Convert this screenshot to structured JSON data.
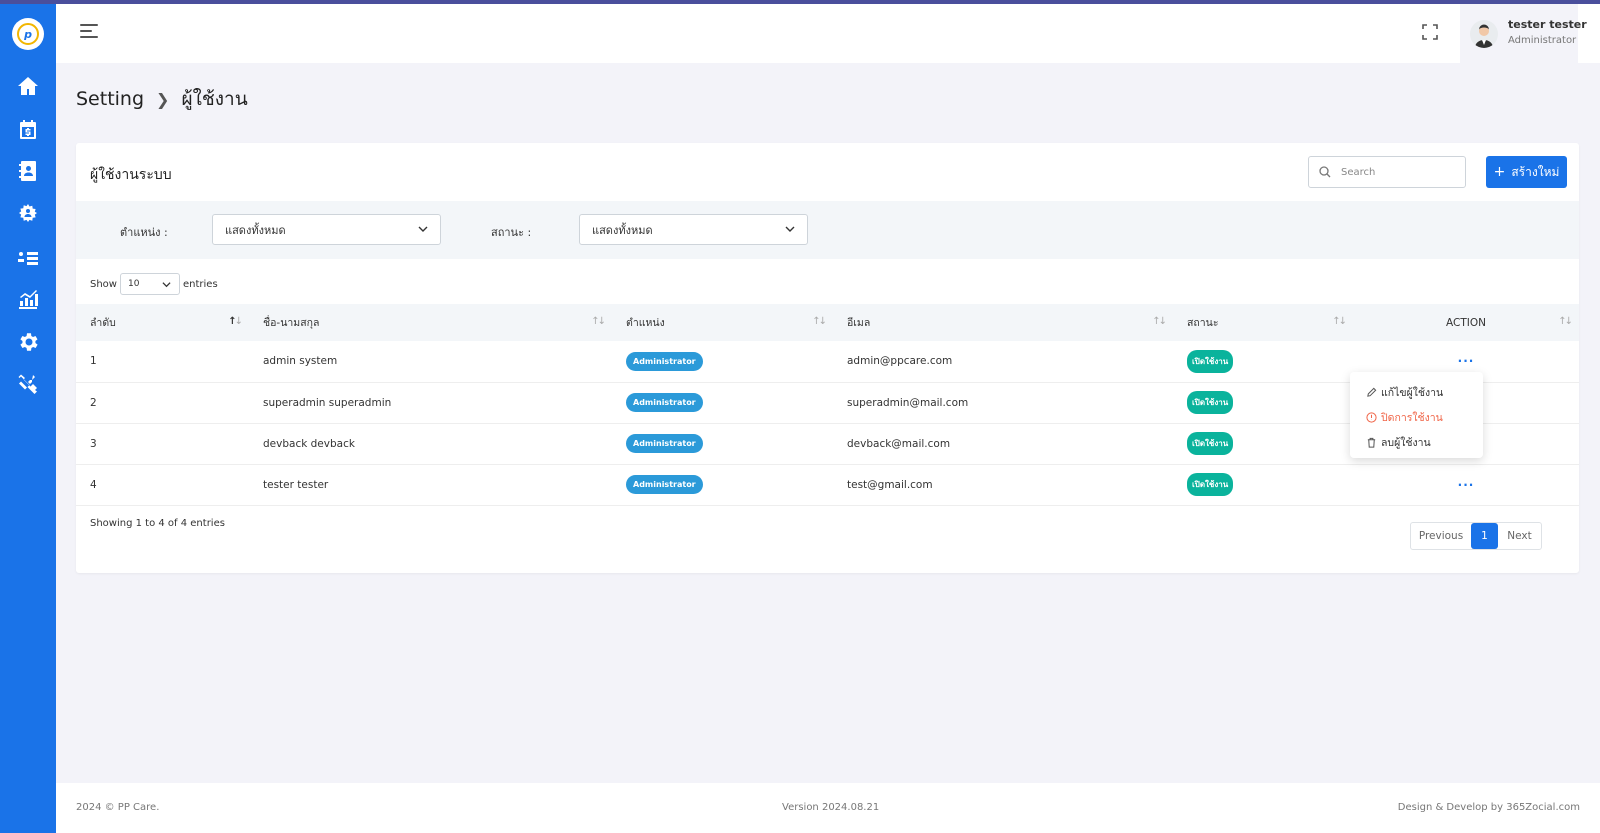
{
  "header": {
    "user_name": "tester tester",
    "user_role": "Administrator"
  },
  "breadcrumb": {
    "parent": "Setting",
    "current": "ผู้ใช้งาน"
  },
  "card": {
    "title": "ผู้ใช้งานระบบ",
    "search_placeholder": "Search",
    "create_label": "สร้างใหม่"
  },
  "filters": {
    "position_label": "ตำแหน่ง :",
    "position_value": "แสดงทั้งหมด",
    "status_label": "สถานะ :",
    "status_value": "แสดงทั้งหมด"
  },
  "length": {
    "show": "Show",
    "value": "10",
    "entries": "entries"
  },
  "table": {
    "columns": [
      "ลำดับ",
      "ชื่อ-นามสกุล",
      "ตำแหน่ง",
      "อีเมล",
      "สถานะ",
      "ACTION"
    ],
    "rows": [
      {
        "no": "1",
        "name": "admin system",
        "role": "Administrator",
        "email": "admin@ppcare.com",
        "status": "เปิดใช้งาน",
        "action": "···"
      },
      {
        "no": "2",
        "name": "superadmin superadmin",
        "role": "Administrator",
        "email": "superadmin@mail.com",
        "status": "เปิดใช้งาน",
        "action": ""
      },
      {
        "no": "3",
        "name": "devback devback",
        "role": "Administrator",
        "email": "devback@mail.com",
        "status": "เปิดใช้งาน",
        "action": ""
      },
      {
        "no": "4",
        "name": "tester tester",
        "role": "Administrator",
        "email": "test@gmail.com",
        "status": "เปิดใช้งาน",
        "action": "···"
      }
    ]
  },
  "action_menu": {
    "edit": "แก้ไขผู้ใช้งาน",
    "disable": "ปิดการใช้งาน",
    "delete": "ลบผู้ใช้งาน"
  },
  "info": "Showing 1 to 4 of 4 entries",
  "pagination": {
    "prev": "Previous",
    "current": "1",
    "next": "Next"
  },
  "footer": {
    "copyright": "2024 © PP Care.",
    "version": "Version 2024.08.21",
    "credit": "Design & Develop by 365Zocial.com"
  },
  "colors": {
    "primary": "#1a73e8",
    "role_badge": "#2b9ad9",
    "status_badge": "#0ab39c",
    "danger": "#f06548"
  }
}
